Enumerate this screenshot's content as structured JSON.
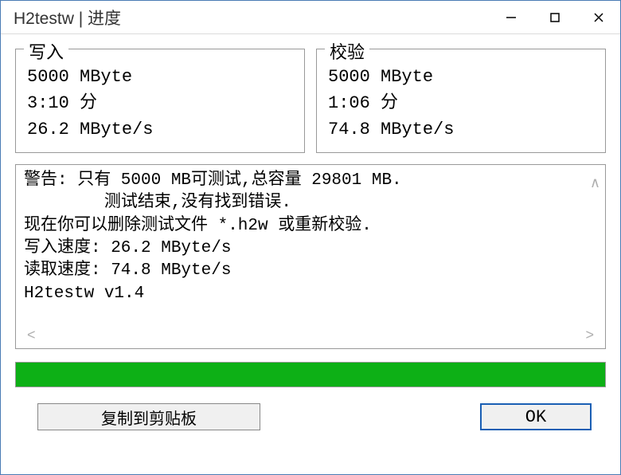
{
  "window": {
    "title": "H2testw | 进度"
  },
  "write": {
    "legend": "写入",
    "size": "5000 MByte",
    "time": "3:10 分",
    "speed": "26.2 MByte/s"
  },
  "verify": {
    "legend": "校验",
    "size": "5000 MByte",
    "time": "1:06 分",
    "speed": "74.8 MByte/s"
  },
  "log": {
    "line1": "警告: 只有 5000 MB可测试,总容量 29801 MB.",
    "line2": "        测试结束,没有找到错误.",
    "line3": "现在你可以删除测试文件 *.h2w 或重新校验.",
    "line4": "写入速度: 26.2 MByte/s",
    "line5": "读取速度: 74.8 MByte/s",
    "line6": "H2testw v1.4"
  },
  "buttons": {
    "copy": "复制到剪贴板",
    "ok": "OK"
  },
  "progress": {
    "percent": 100
  }
}
